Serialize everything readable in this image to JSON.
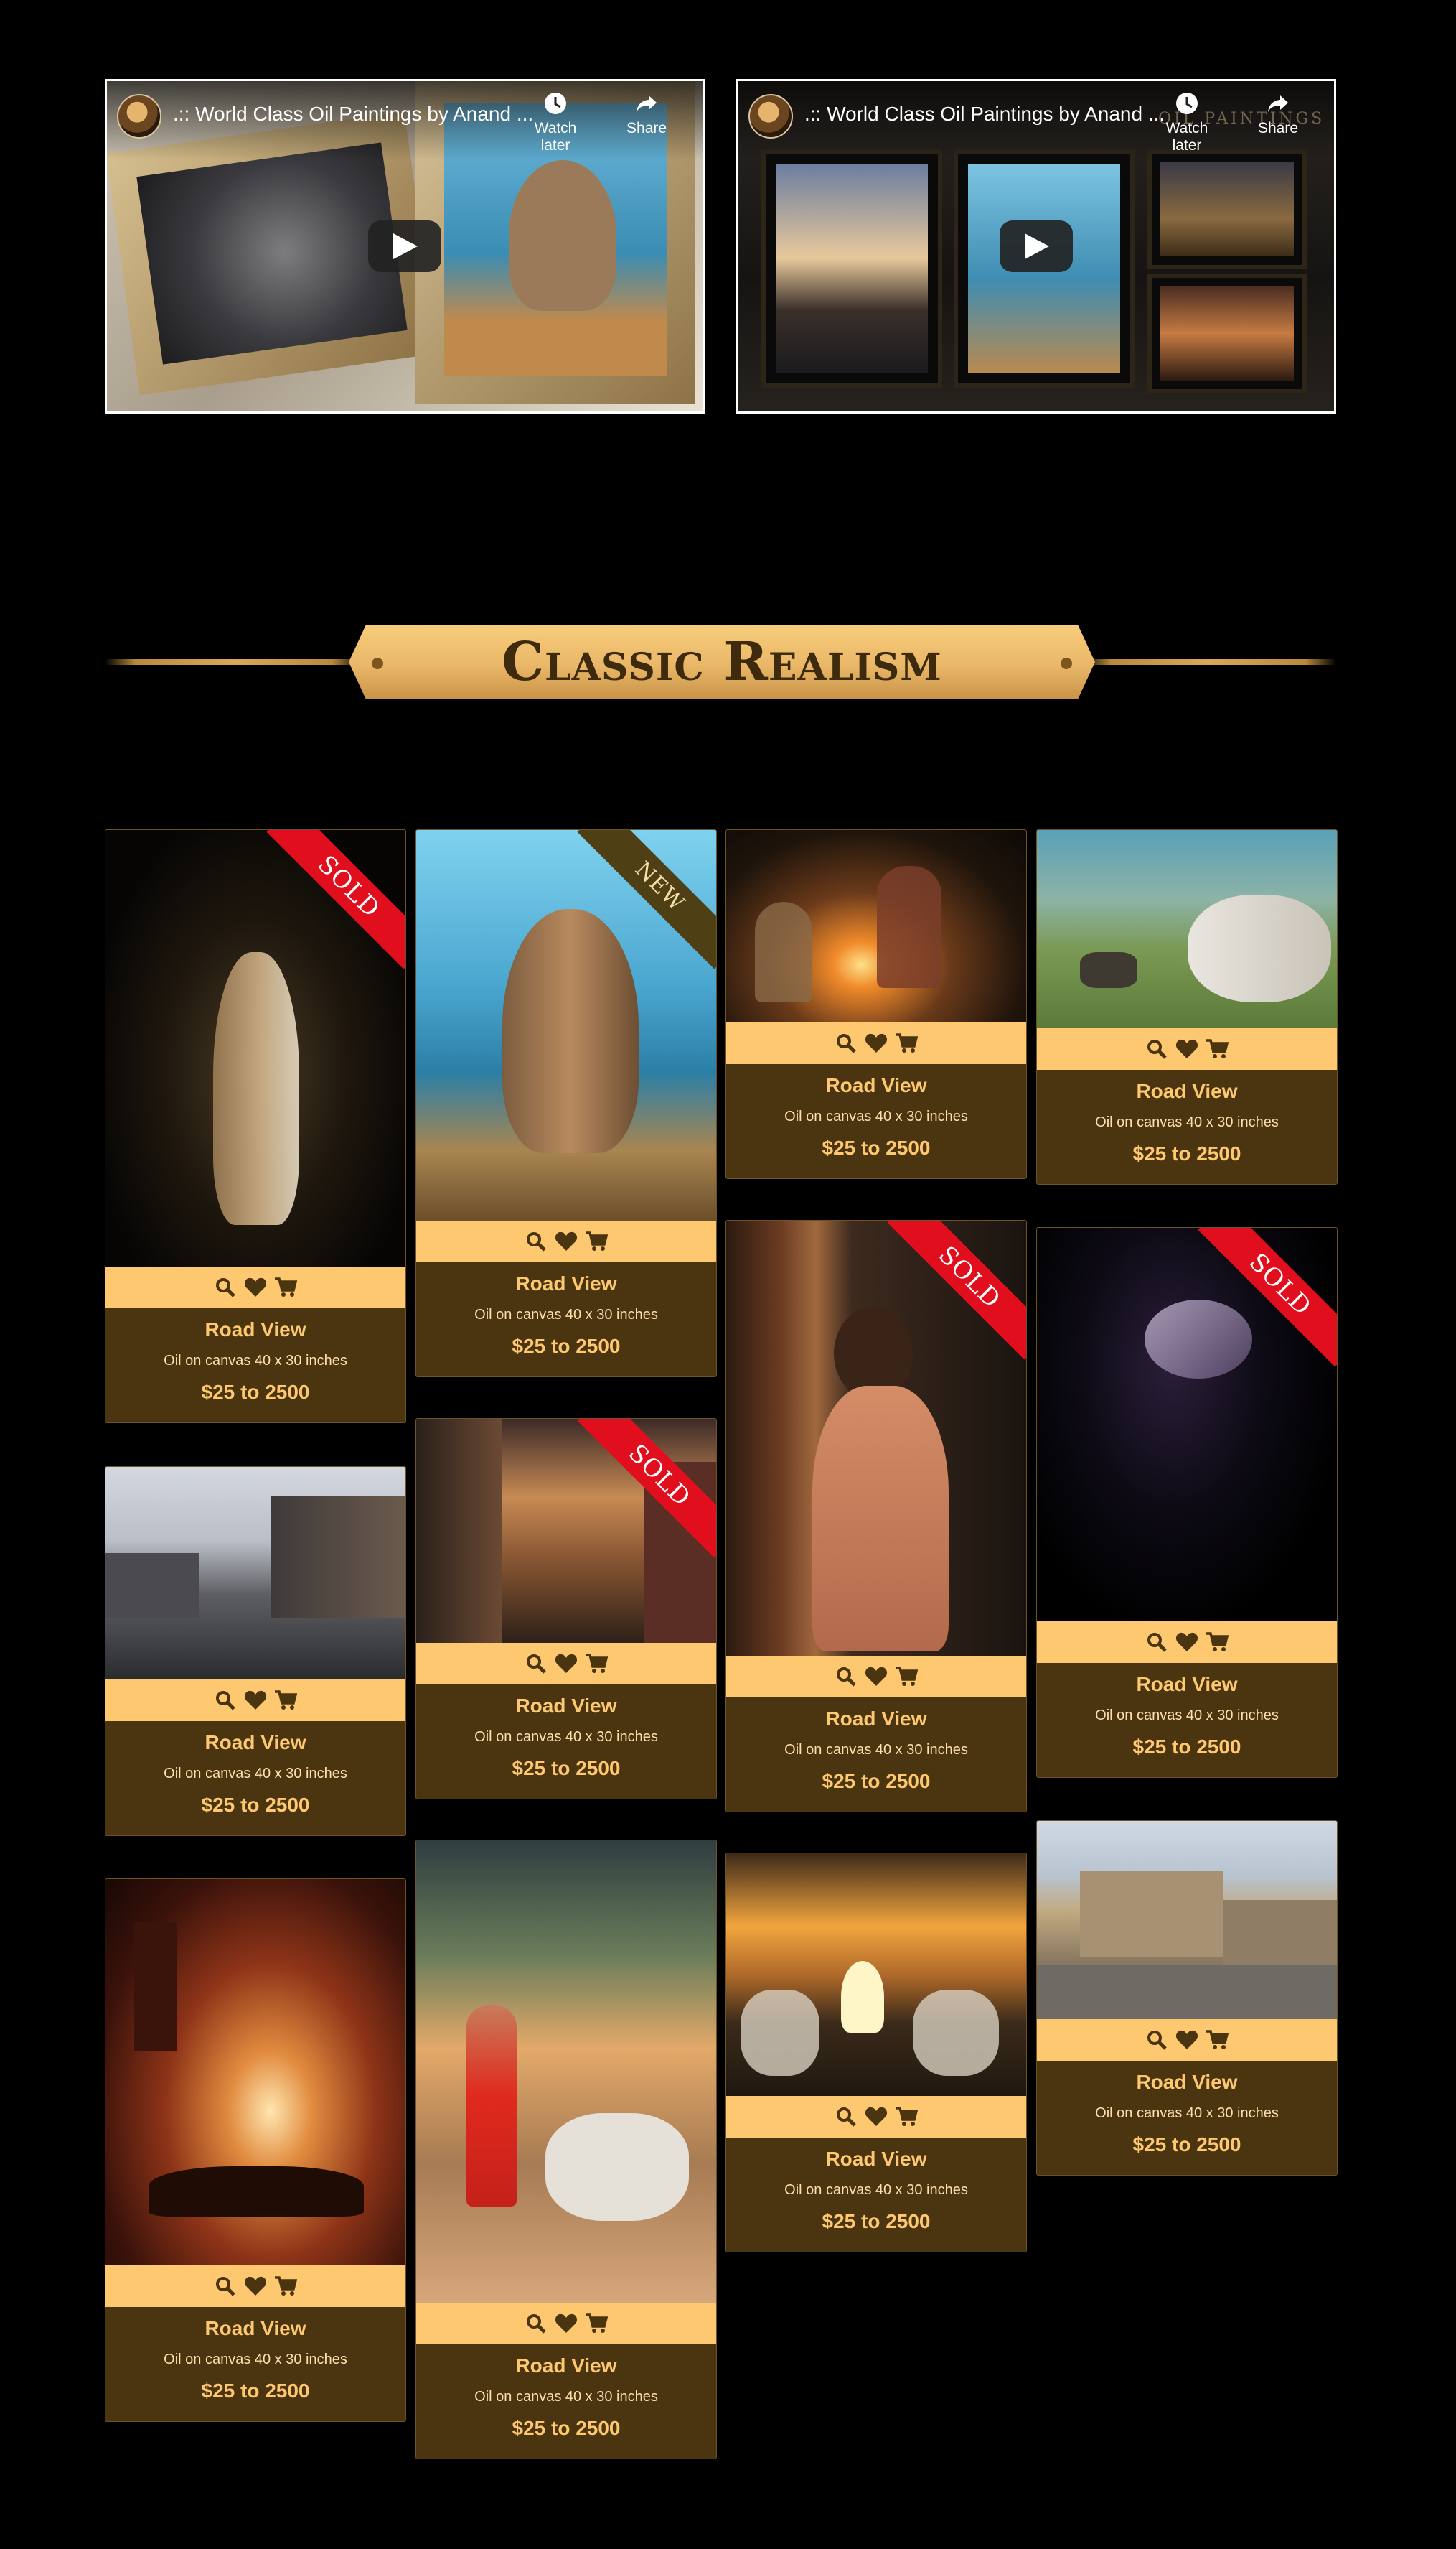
{
  "videos": [
    {
      "title": ".:: World Class Oil Paintings by Anand ...",
      "watch_later": "Watch later",
      "share": "Share"
    },
    {
      "title": ".:: World Class Oil Paintings by Anand ...",
      "watch_later": "Watch later",
      "share": "Share",
      "watermark": "OIL PAINTINGS"
    }
  ],
  "section": {
    "title": "Classic Realism"
  },
  "ribbons": {
    "sold": "SOLD",
    "new": "NEW"
  },
  "icons": [
    "search-icon",
    "heart-icon",
    "cart-icon"
  ],
  "colors": {
    "background": "#000000",
    "card": "#4b3410",
    "accent": "#fdc870",
    "ribbon_sold": "#e10f1e"
  },
  "cards": [
    {
      "title": "Road View",
      "medium": "Oil on canvas 40 x 30 inches",
      "price": "$25 to 2500",
      "badge": "SOLD",
      "subject": "woman-portrait"
    },
    {
      "title": "Road View",
      "medium": "Oil on canvas 40 x 30 inches",
      "price": "$25 to 2500",
      "badge": "",
      "subject": "street-scene"
    },
    {
      "title": "Road View",
      "medium": "Oil on canvas 40 x 30 inches",
      "price": "$25 to 2500",
      "badge": "",
      "subject": "horse-cart"
    },
    {
      "title": "Road View",
      "medium": "Oil on canvas 40 x 30 inches",
      "price": "$25 to 2500",
      "badge": "NEW",
      "subject": "elephant"
    },
    {
      "title": "Road View",
      "medium": "Oil on canvas 40 x 30 inches",
      "price": "$25 to 2500",
      "badge": "SOLD",
      "subject": "city-street"
    },
    {
      "title": "Road View",
      "medium": "Oil on canvas 40 x 30 inches",
      "price": "$25 to 2500",
      "badge": "",
      "subject": "goat-herder"
    },
    {
      "title": "Road View",
      "medium": "Oil on canvas 40 x 30 inches",
      "price": "$25 to 2500",
      "badge": "",
      "subject": "campfire"
    },
    {
      "title": "Road View",
      "medium": "Oil on canvas 40 x 30 inches",
      "price": "$25 to 2500",
      "badge": "SOLD",
      "subject": "girl-at-window"
    },
    {
      "title": "Road View",
      "medium": "Oil on canvas 40 x 30 inches",
      "price": "$25 to 2500",
      "badge": "",
      "subject": "campfire-sunset"
    },
    {
      "title": "Road View",
      "medium": "Oil on canvas 40 x 30 inches",
      "price": "$25 to 2500",
      "badge": "",
      "subject": "tiger-savanna"
    },
    {
      "title": "Road View",
      "medium": "Oil on canvas 40 x 30 inches",
      "price": "$25 to 2500",
      "badge": "SOLD",
      "subject": "dark-portrait"
    },
    {
      "title": "Road View",
      "medium": "Oil on canvas 40 x 30 inches",
      "price": "$25 to 2500",
      "badge": "",
      "subject": "old-town"
    }
  ]
}
